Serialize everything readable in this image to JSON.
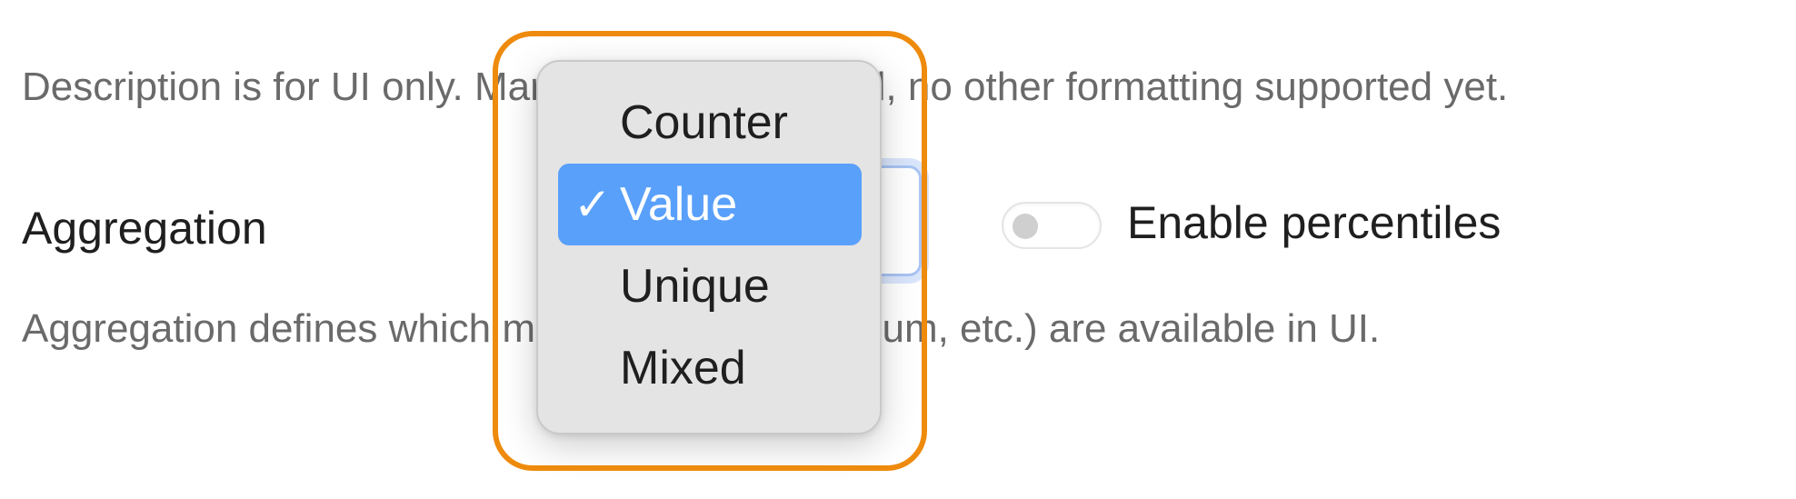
{
  "description_help": "Description is for UI only. Markdown is respected, no other formatting supported yet.",
  "aggregation": {
    "label": "Aggregation",
    "help": "Aggregation defines which metrics (count, avg, sum, etc.) are available in UI.",
    "selected_value": "Value",
    "options": [
      {
        "label": "Counter",
        "selected": false
      },
      {
        "label": "Value",
        "selected": true
      },
      {
        "label": "Unique",
        "selected": false
      },
      {
        "label": "Mixed",
        "selected": false
      }
    ],
    "check_glyph": "✓"
  },
  "percentiles": {
    "label": "Enable percentiles",
    "enabled": false
  },
  "colors": {
    "highlight": "#ee8a0c",
    "selected_item": "#59a0fb",
    "focus_ring": "#a8c4f3"
  }
}
